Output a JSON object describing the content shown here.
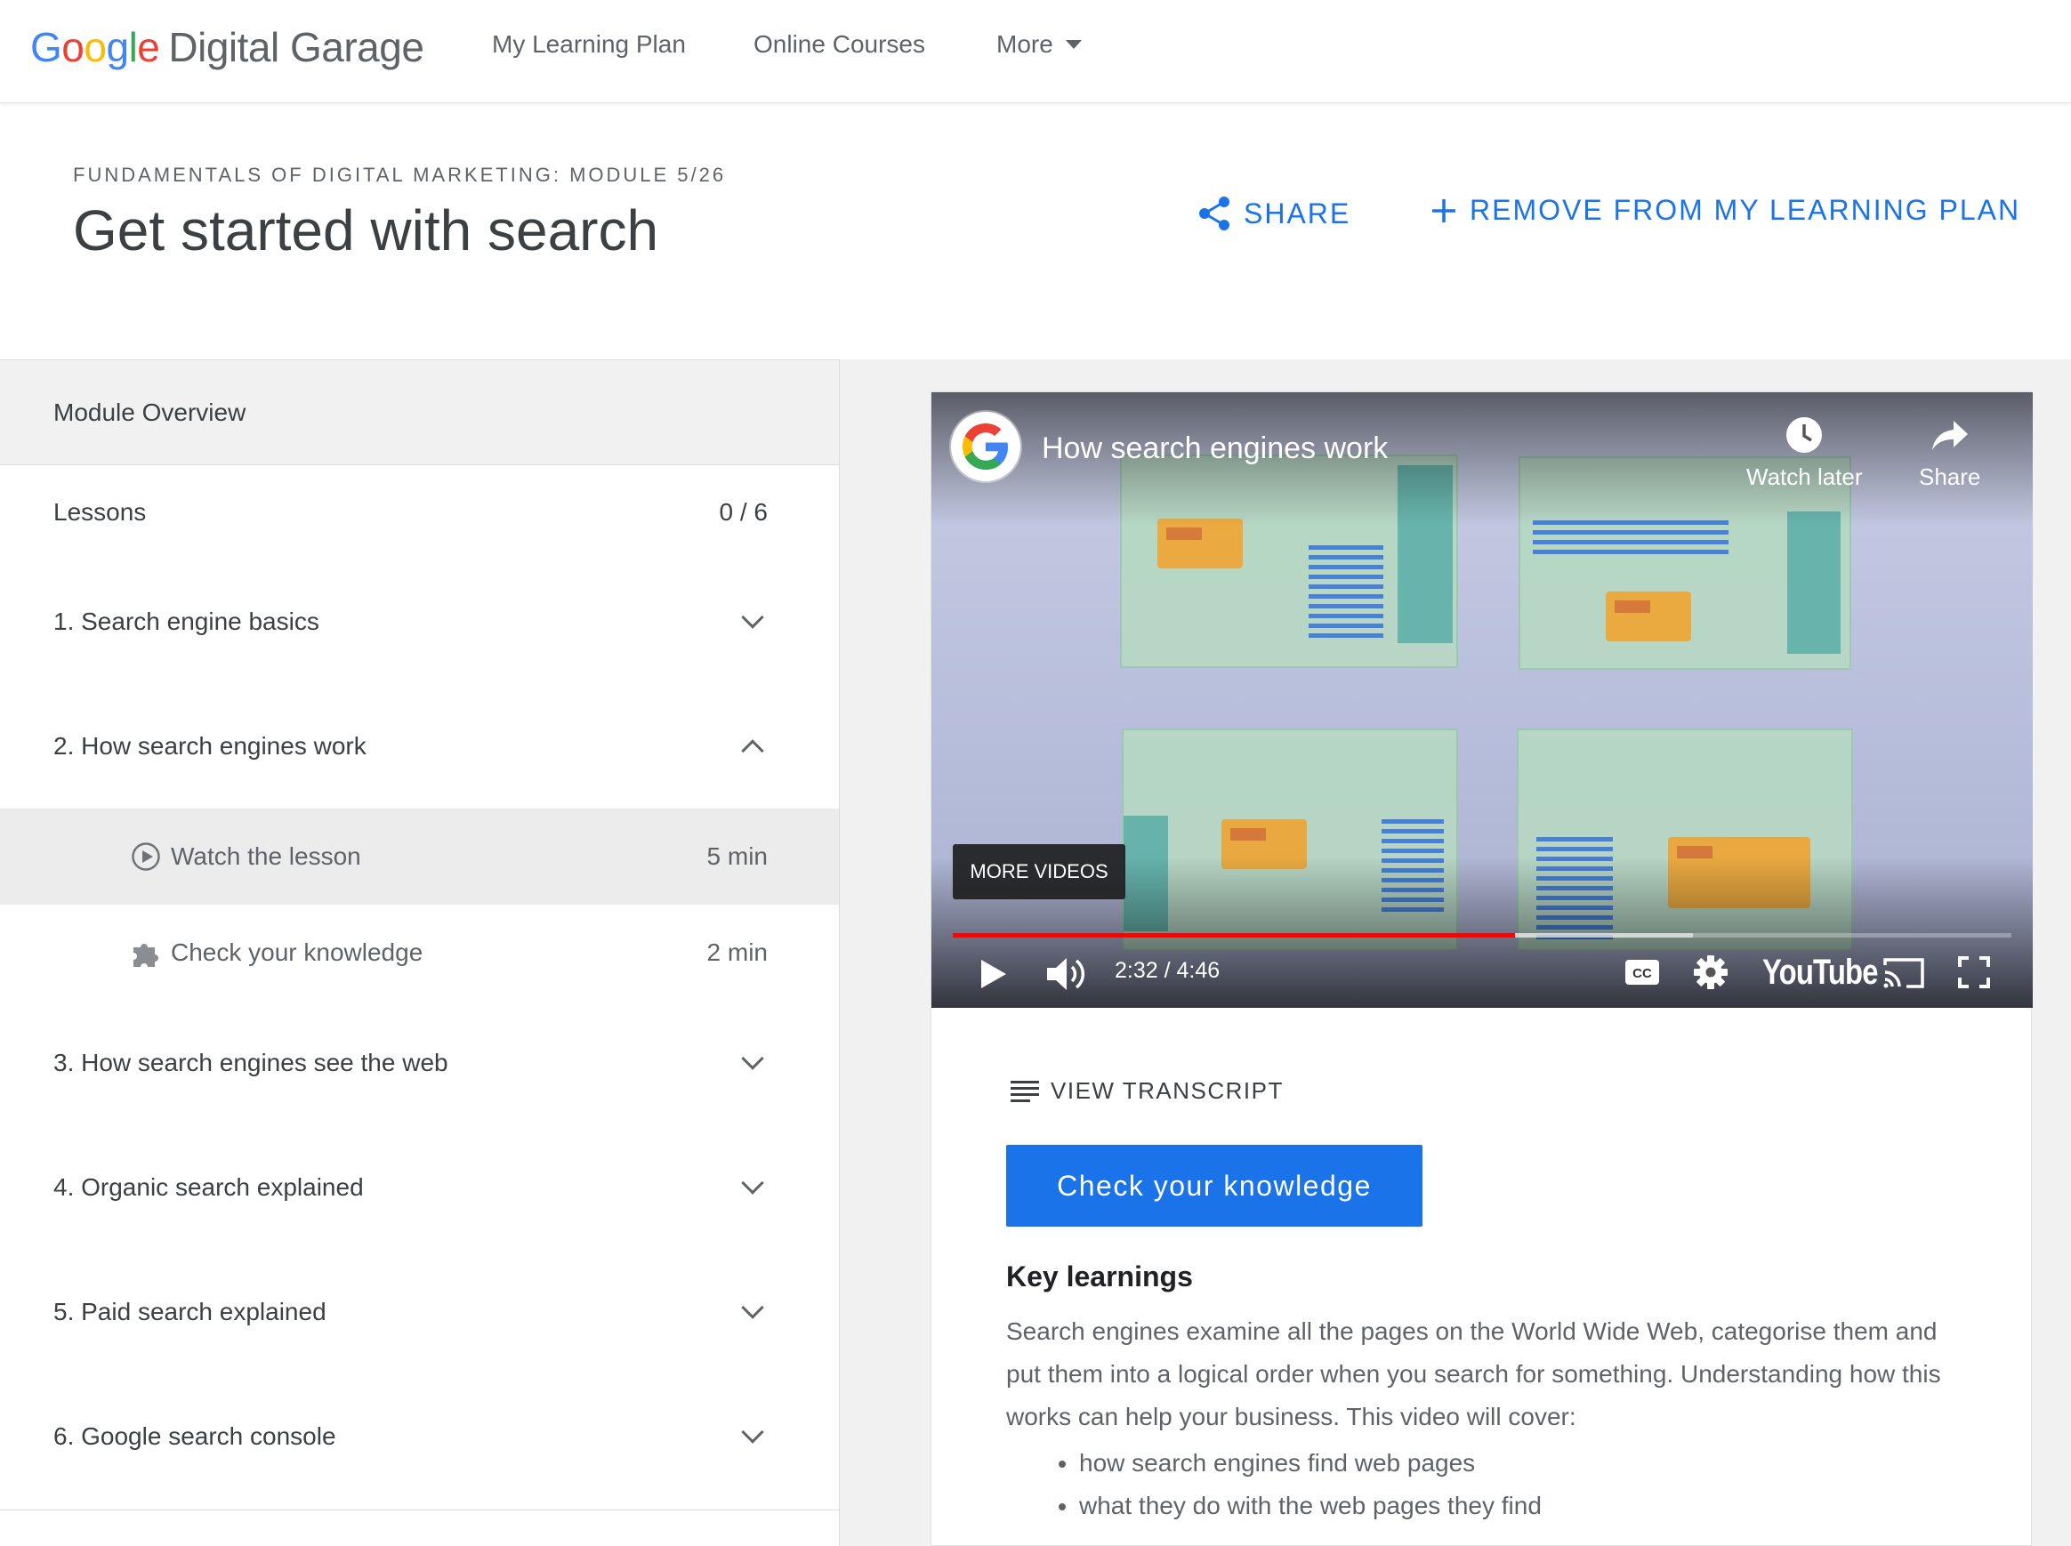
{
  "nav": {
    "logo_google": [
      "G",
      "o",
      "o",
      "g",
      "l",
      "e"
    ],
    "logo_rest": "Digital Garage",
    "links": [
      "My Learning Plan",
      "Online Courses"
    ],
    "more": "More"
  },
  "header": {
    "eyebrow": "FUNDAMENTALS OF DIGITAL MARKETING: MODULE 5/26",
    "title": "Get started with search",
    "share": "SHARE",
    "remove": "REMOVE FROM MY LEARNING PLAN",
    "accent": "#1a73e8"
  },
  "sidebar": {
    "overview": "Module Overview",
    "lessons_label": "Lessons",
    "lessons_progress": "0 / 6",
    "lessons": [
      {
        "label": "1. Search engine basics",
        "expanded": false
      },
      {
        "label": "2. How search engines work",
        "expanded": true
      },
      {
        "label": "3. How search engines see the web",
        "expanded": false
      },
      {
        "label": "4. Organic search explained",
        "expanded": false
      },
      {
        "label": "5. Paid search explained",
        "expanded": false
      },
      {
        "label": "6. Google search console",
        "expanded": false
      }
    ],
    "subitems": [
      {
        "label": "Watch the lesson",
        "duration": "5 min",
        "icon": "play-circle-icon",
        "active": true
      },
      {
        "label": "Check your knowledge",
        "duration": "2 min",
        "icon": "puzzle-icon",
        "active": false
      }
    ]
  },
  "video": {
    "title": "How search engines work",
    "watch_later": "Watch later",
    "share": "Share",
    "more_videos": "MORE VIDEOS",
    "time": "2:32 / 4:46",
    "progress_fraction": 0.531,
    "buffered_fraction": 0.699,
    "brand": "YouTube",
    "progress_color": "#ff0000"
  },
  "content": {
    "transcript": "VIEW TRANSCRIPT",
    "cta": "Check your knowledge",
    "key_title": "Key learnings",
    "key_body": "Search engines examine all the pages on the World Wide Web, categorise them and put them into a logical order when you search for something. Understanding how this works can help your business. This video will cover:",
    "bullets": [
      "how search engines find web pages",
      "what they do with the web pages they find"
    ]
  }
}
